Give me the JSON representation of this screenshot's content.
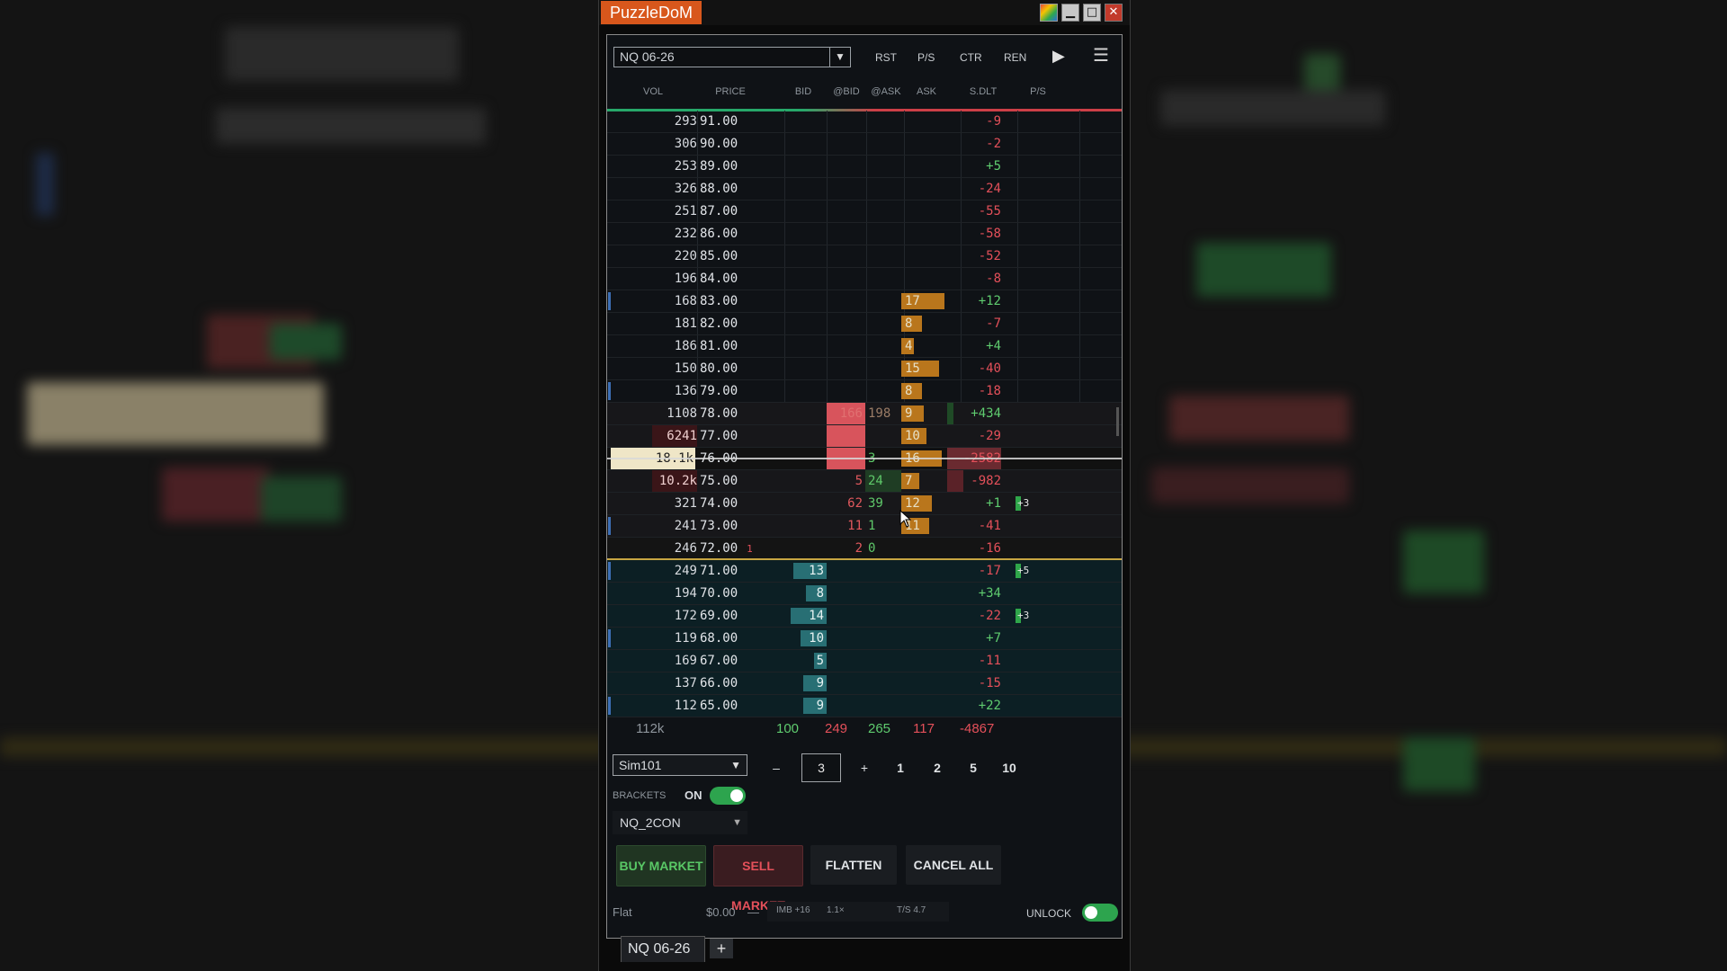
{
  "app": {
    "title": "PuzzleDoM"
  },
  "window_buttons": {
    "minimize": "▁",
    "maximize": "□",
    "close": "✕"
  },
  "toolbar": {
    "instrument": "NQ 06-26",
    "buttons": [
      "RST",
      "P/S",
      "CTR",
      "REN"
    ],
    "play_icon": "▶",
    "menu_icon": "☰"
  },
  "columns": [
    "VOL",
    "PRICE",
    "BID",
    "@BID",
    "@ASK",
    "ASK",
    "S.DLT",
    "P/S"
  ],
  "ladder": [
    {
      "vol": "293",
      "price": "91.00",
      "sdlt": "-9"
    },
    {
      "vol": "306",
      "price": "90.00",
      "sdlt": "-2"
    },
    {
      "vol": "253",
      "price": "89.00",
      "sdlt": "+5"
    },
    {
      "vol": "326",
      "price": "88.00",
      "sdlt": "-24"
    },
    {
      "vol": "251",
      "price": "87.00",
      "sdlt": "-55"
    },
    {
      "vol": "232",
      "price": "86.00",
      "sdlt": "-58"
    },
    {
      "vol": "220",
      "price": "85.00",
      "sdlt": "-52"
    },
    {
      "vol": "196",
      "price": "84.00",
      "sdlt": "-8"
    },
    {
      "vol": "168",
      "price": "83.00",
      "ask": "17",
      "sdlt": "+12"
    },
    {
      "vol": "181",
      "price": "82.00",
      "ask": "8",
      "sdlt": "-7"
    },
    {
      "vol": "186",
      "price": "81.00",
      "ask": "4",
      "sdlt": "+4"
    },
    {
      "vol": "150",
      "price": "80.00",
      "ask": "15",
      "sdlt": "-40"
    },
    {
      "vol": "136",
      "price": "79.00",
      "ask": "8",
      "sdlt": "-18"
    },
    {
      "vol": "1108",
      "price": "78.00",
      "abid": "166",
      "aask": "198",
      "ask": "9",
      "sdlt": "+434"
    },
    {
      "vol": "6241",
      "price": "77.00",
      "ask": "10",
      "sdlt": "-29"
    },
    {
      "vol": "18.1k",
      "price": "76.00",
      "aask": "3",
      "ask": "16",
      "sdlt": "-2582"
    },
    {
      "vol": "10.2k",
      "price": "75.00",
      "abid": "5",
      "aask": "24",
      "ask": "7",
      "sdlt": "-982"
    },
    {
      "vol": "321",
      "price": "74.00",
      "abid": "62",
      "aask": "39",
      "ask": "12",
      "sdlt": "+1",
      "ps": "+3"
    },
    {
      "vol": "241",
      "price": "73.00",
      "abid": "11",
      "aask": "1",
      "ask": "11",
      "sdlt": "-41"
    },
    {
      "vol": "246",
      "price": "72.00",
      "note": "1",
      "abid": "2",
      "aask": "0",
      "sdlt": "-16"
    },
    {
      "vol": "249",
      "price": "71.00",
      "bid": "13",
      "sdlt": "-17",
      "ps": "+5"
    },
    {
      "vol": "194",
      "price": "70.00",
      "bid": "8",
      "sdlt": "+34"
    },
    {
      "vol": "172",
      "price": "69.00",
      "bid": "14",
      "sdlt": "-22",
      "ps": "+3"
    },
    {
      "vol": "119",
      "price": "68.00",
      "bid": "10",
      "sdlt": "+7"
    },
    {
      "vol": "169",
      "price": "67.00",
      "bid": "5",
      "sdlt": "-11"
    },
    {
      "vol": "137",
      "price": "66.00",
      "bid": "9",
      "sdlt": "-15"
    },
    {
      "vol": "112",
      "price": "65.00",
      "bid": "9",
      "sdlt": "+22"
    }
  ],
  "totals": {
    "vol": "112k",
    "bid": "100",
    "abid": "249",
    "aask": "265",
    "ask": "117",
    "sdlt": "-4867"
  },
  "order": {
    "account": "Sim101",
    "minus": "–",
    "qty": "3",
    "plus": "+",
    "presets": [
      "1",
      "2",
      "5",
      "10"
    ],
    "brackets_label": "BRACKETS",
    "brackets_state": "ON",
    "strategy": "NQ_2CON",
    "buy": "BUY MARKET",
    "sell": "SELL MARKET",
    "flatten": "FLATTEN",
    "cancel": "CANCEL ALL"
  },
  "status": {
    "position": "Flat",
    "pnl": "$0.00",
    "dash": "—",
    "imb": "IMB +16",
    "ratio": "1.1×",
    "ts": "T/S 4.7",
    "unlock": "UNLOCK"
  },
  "tabs": {
    "active": "NQ 06-26",
    "add": "+"
  },
  "colors": {
    "title": "#d8571c",
    "bid_bar": "#2e7e82",
    "ask_bar": "#b9761c",
    "positive": "#5fcc6f",
    "negative": "#e4505a",
    "toggle": "#2da44e"
  }
}
